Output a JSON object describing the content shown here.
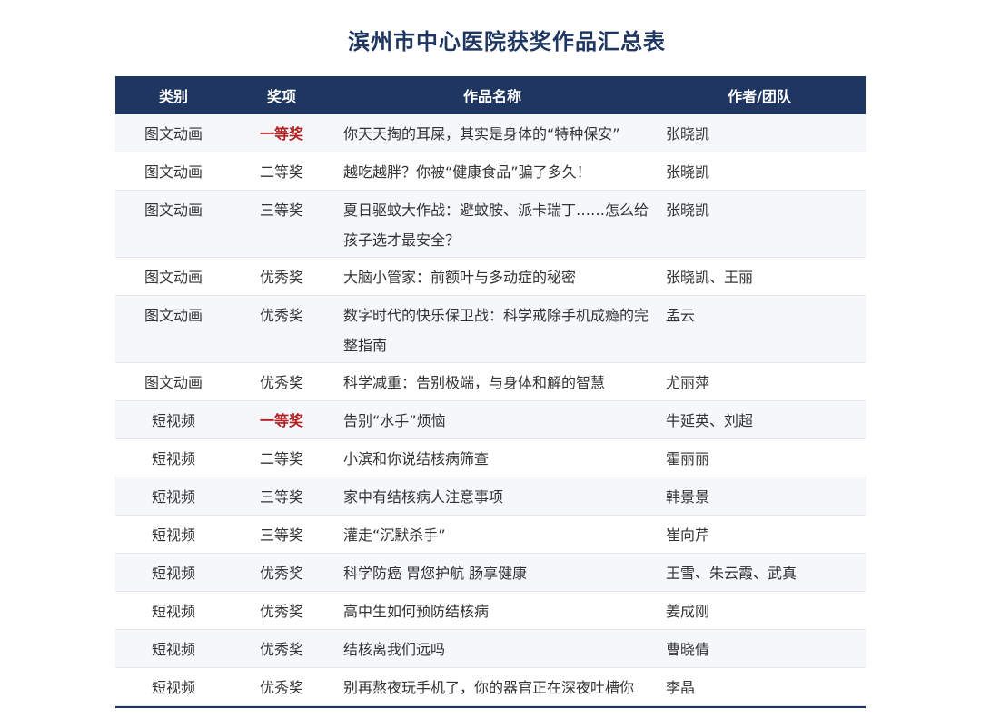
{
  "title": "滨州市中心医院获奖作品汇总表",
  "headers": [
    "类别",
    "奖项",
    "作品名称",
    "作者/团队"
  ],
  "rows": [
    {
      "category": "图文动画",
      "award": "一等奖",
      "work": "你天天掏的耳屎，其实是身体的“特种保安”",
      "author": "张晓凯",
      "first": true
    },
    {
      "category": "图文动画",
      "award": "二等奖",
      "work": "越吃越胖？你被“健康食品”骗了多久！",
      "author": "张晓凯"
    },
    {
      "category": "图文动画",
      "award": "三等奖",
      "work": "夏日驱蚊大作战：避蚊胺、派卡瑞丁……怎么给孩子选才最安全？",
      "author": "张晓凯",
      "tall": true
    },
    {
      "category": "图文动画",
      "award": "优秀奖",
      "work": "大脑小管家：前额叶与多动症的秘密",
      "author": "张晓凯、王丽"
    },
    {
      "category": "图文动画",
      "award": "优秀奖",
      "work": "数字时代的快乐保卫战：科学戒除手机成瘾的完整指南",
      "author": "孟云",
      "tall": true
    },
    {
      "category": "图文动画",
      "award": "优秀奖",
      "work": "科学减重：告别极端，与身体和解的智慧",
      "author": "尤丽萍"
    },
    {
      "category": "短视频",
      "award": "一等奖",
      "work": "告别“水手”烦恼",
      "author": "牛延英、刘超",
      "first": true
    },
    {
      "category": "短视频",
      "award": "二等奖",
      "work": "小滨和你说结核病筛查",
      "author": "霍丽丽"
    },
    {
      "category": "短视频",
      "award": "三等奖",
      "work": "家中有结核病人注意事项",
      "author": "韩景景"
    },
    {
      "category": "短视频",
      "award": "三等奖",
      "work": "灌走“沉默杀手”",
      "author": "崔向芹"
    },
    {
      "category": "短视频",
      "award": "优秀奖",
      "work": "科学防癌 胃您护航 肠享健康",
      "author": "王雪、朱云霞、武真"
    },
    {
      "category": "短视频",
      "award": "优秀奖",
      "work": "高中生如何预防结核病",
      "author": "姜成刚"
    },
    {
      "category": "短视频",
      "award": "优秀奖",
      "work": "结核离我们远吗",
      "author": "曹晓倩"
    },
    {
      "category": "短视频",
      "award": "优秀奖",
      "work": "别再熬夜玩手机了，你的器官正在深夜吐槽你",
      "author": "李晶"
    }
  ]
}
